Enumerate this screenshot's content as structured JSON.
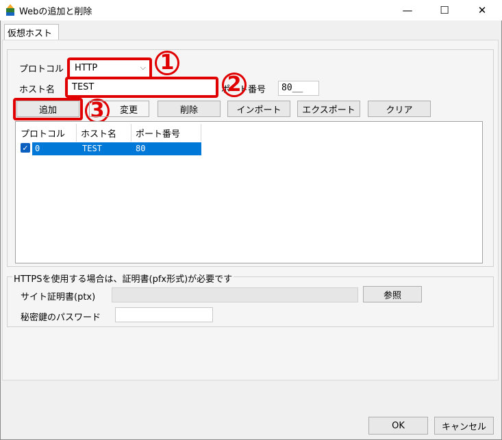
{
  "window": {
    "title": "Webの追加と削除",
    "minimize": "—",
    "maximize": "☐",
    "close": "✕"
  },
  "tab": {
    "label": "仮想ホスト"
  },
  "form": {
    "protocol_label": "プロトコル",
    "protocol_value": "HTTP",
    "host_label": "ホスト名",
    "host_value": "TEST",
    "port_label": "ポート番号",
    "port_value": "80__"
  },
  "buttons": {
    "add": "追加",
    "change": "変更",
    "delete": "削除",
    "import": "インポート",
    "export": "エクスポート",
    "clear": "クリア"
  },
  "table": {
    "headers": [
      "プロトコル",
      "ホスト名",
      "ポート番号"
    ],
    "rows": [
      {
        "protocol": "0",
        "host": "TEST",
        "port": "80",
        "checked": true
      }
    ]
  },
  "https": {
    "note": "HTTPSを使用する場合は、証明書(pfx形式)が必要です",
    "cert_label": "サイト証明書(ptx)",
    "browse": "参照",
    "password_label": "秘密鍵のパスワード"
  },
  "footer": {
    "ok": "OK",
    "cancel": "キャンセル"
  },
  "annotations": {
    "n1": "1",
    "n2": "2",
    "n3": "3"
  },
  "colors": {
    "accent": "#e00000",
    "selection": "#0078d7"
  }
}
